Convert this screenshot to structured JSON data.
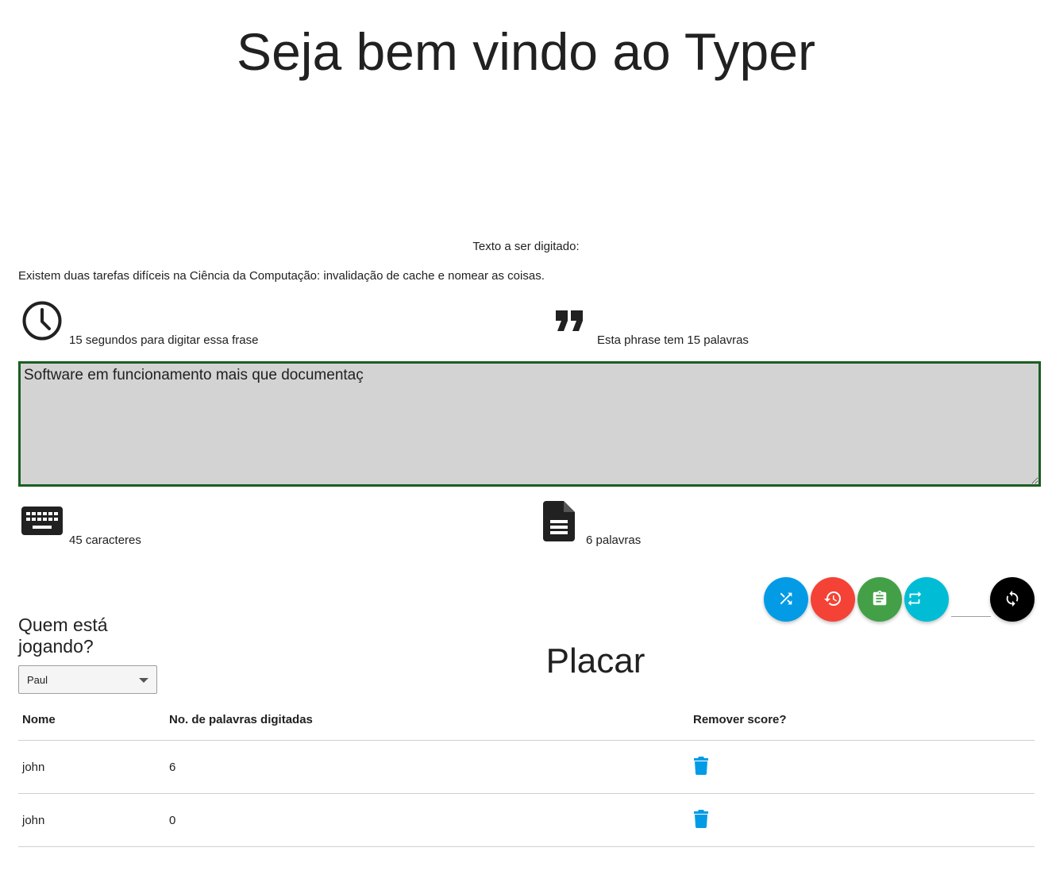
{
  "header": {
    "title": "Seja bem vindo ao Typer"
  },
  "phrase": {
    "label": "Texto a ser digitado:",
    "text": "Existem duas tarefas difíceis na Ciência da Computação: invalidação de cache e nomear as coisas."
  },
  "stats": {
    "time_text": "15 segundos para digitar essa frase",
    "phrase_words_text": "Esta phrase tem 15 palavras",
    "chars_text": "45 caracteres",
    "words_text": "6 palavras"
  },
  "input": {
    "value": "Software em funcionamento mais que documentaç"
  },
  "actions": {
    "shuffle_color": "#039be5",
    "history_color": "#f44336",
    "clipboard_color": "#43a047",
    "repeat_color": "#00bcd4",
    "sync_color": "#000000",
    "seconds_value": ""
  },
  "player": {
    "heading": "Quem está jogando?",
    "selected": "Paul"
  },
  "scoreboard": {
    "title": "Placar",
    "headers": {
      "name": "Nome",
      "words": "No. de palavras digitadas",
      "remove": "Remover score?"
    },
    "rows": [
      {
        "name": "john",
        "words": "6"
      },
      {
        "name": "john",
        "words": "0"
      }
    ]
  },
  "colors": {
    "accent": "#039be5",
    "input_border": "#1b5e20",
    "input_bg": "#d3d3d3"
  }
}
